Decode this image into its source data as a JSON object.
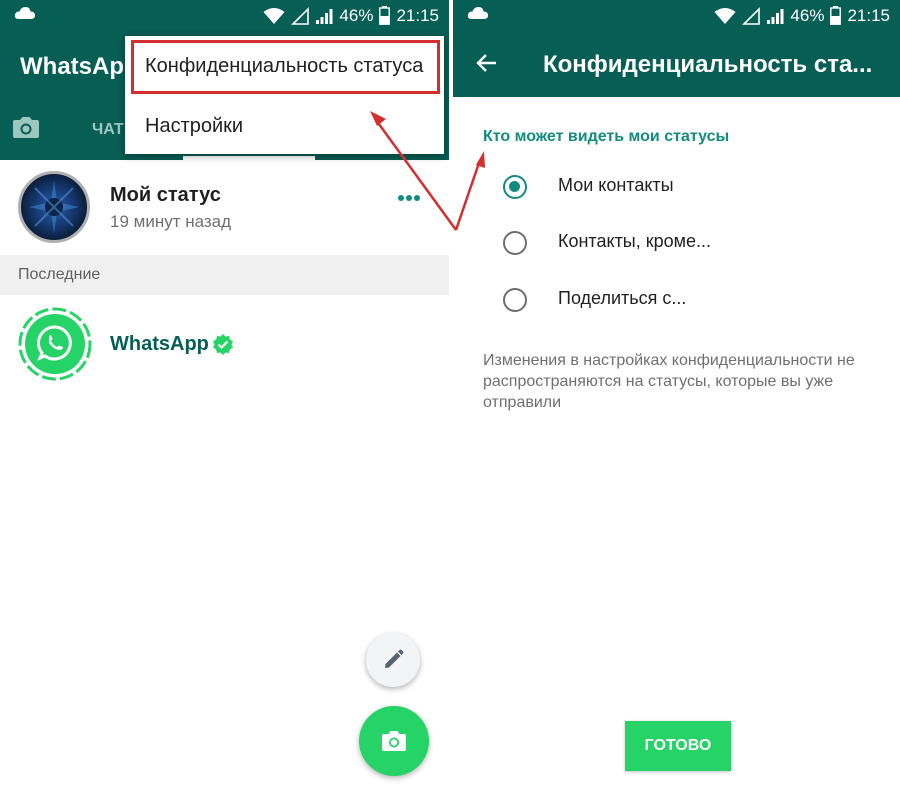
{
  "status_bar": {
    "battery": "46%",
    "time": "21:15",
    "icons": [
      "cloud-icon",
      "wifi-icon",
      "no-signal-icon",
      "signal-icon",
      "battery-icon"
    ]
  },
  "left": {
    "app_title": "WhatsApp",
    "tabs": {
      "chats_partial": "ЧАТ"
    },
    "menu": {
      "items": [
        "Конфиденциальность статуса",
        "Настройки"
      ]
    },
    "my_status": {
      "name": "Мой статус",
      "time": "19 минут назад"
    },
    "section_recent": "Последние",
    "contact": {
      "name": "WhatsApp"
    }
  },
  "right": {
    "title": "Конфиденциальность ста...",
    "section": "Кто может видеть мои статусы",
    "options": [
      {
        "label": "Мои контакты",
        "checked": true
      },
      {
        "label": "Контакты, кроме...",
        "checked": false
      },
      {
        "label": "Поделиться с...",
        "checked": false
      }
    ],
    "note": "Изменения в настройках конфиденциальности не распространяются на статусы, которые вы уже отправили",
    "done": "ГОТОВО"
  },
  "colors": {
    "primary_dark": "#075e54",
    "accent": "#25d366",
    "teal": "#128c7e",
    "highlight": "#d32f2f"
  }
}
